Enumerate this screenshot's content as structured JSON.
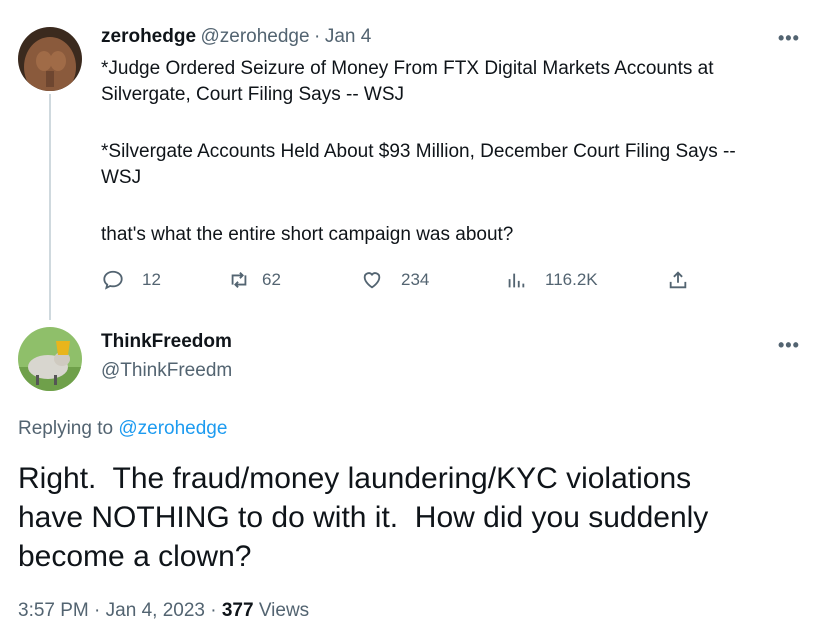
{
  "tweet1": {
    "name": "zerohedge",
    "handle": "@zerohedge",
    "separator": "·",
    "date": "Jan 4",
    "more": "•••",
    "lines": [
      "*Judge Ordered Seizure of Money From FTX Digital Markets Accounts at",
      "Silvergate, Court Filing Says -- WSJ",
      "*Silvergate Accounts Held About $93 Million, December Court Filing Says --",
      "WSJ",
      "that's what the entire short campaign was about?"
    ],
    "actions": {
      "reply_count": "12",
      "retweet_count": "62",
      "like_count": "234",
      "views_count": "116.2K"
    }
  },
  "tweet2": {
    "name": "ThinkFreedom",
    "handle": "@ThinkFreedm",
    "more": "•••",
    "replying_prefix": "Replying to",
    "replying_handle": "@zerohedge",
    "lines": [
      "Right.  The fraud/money laundering/KYC violations",
      "have NOTHING to do with it.  How did you suddenly",
      "become a clown?"
    ],
    "time": "3:57 PM",
    "dot": "·",
    "date": "Jan 4, 2023",
    "views_count": "377",
    "views_label": "Views"
  },
  "colors": {
    "accent": "#1d9bf0",
    "muted": "#536471",
    "text": "#0f1419"
  }
}
